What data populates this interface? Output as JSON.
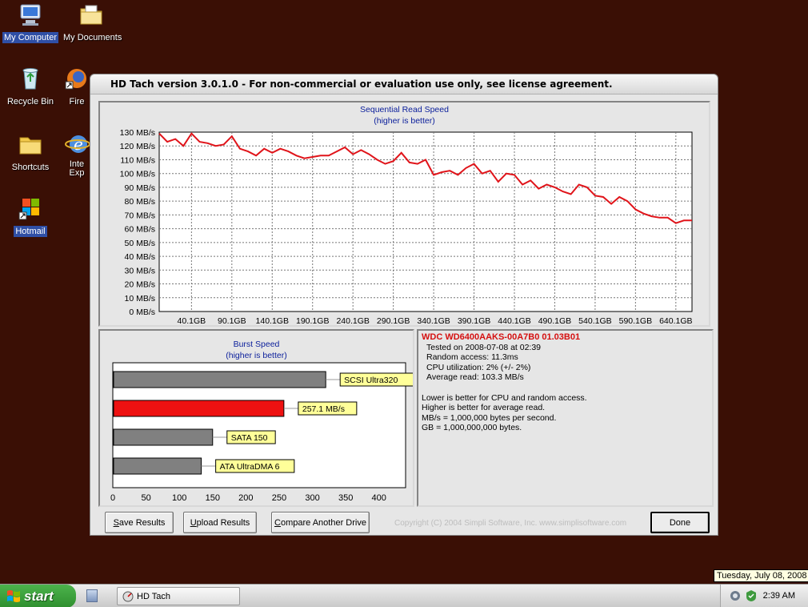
{
  "desktop": {
    "icons": [
      {
        "label": "My Computer"
      },
      {
        "label": "My Documents"
      },
      {
        "label": "Recycle Bin"
      },
      {
        "label": "Fire"
      },
      {
        "label": "Shortcuts"
      },
      {
        "label": "Inte Exp"
      },
      {
        "label": "Hotmail"
      }
    ]
  },
  "window": {
    "title": "HD Tach version 3.0.1.0  - For non-commercial or evaluation use only, see license agreement."
  },
  "seq_chart": {
    "title": "Sequential Read Speed",
    "subtitle": "(higher is better)",
    "y_ticks": [
      "130 MB/s",
      "120 MB/s",
      "110 MB/s",
      "100 MB/s",
      "90 MB/s",
      "80 MB/s",
      "70 MB/s",
      "60 MB/s",
      "50 MB/s",
      "40 MB/s",
      "30 MB/s",
      "20 MB/s",
      "10 MB/s",
      "0 MB/s"
    ],
    "x_ticks": [
      "40.1GB",
      "90.1GB",
      "140.1GB",
      "190.1GB",
      "240.1GB",
      "290.1GB",
      "340.1GB",
      "390.1GB",
      "440.1GB",
      "490.1GB",
      "540.1GB",
      "590.1GB",
      "640.1GB"
    ],
    "line_color": "#e0141a"
  },
  "chart_data": [
    {
      "type": "line",
      "title": "Sequential Read Speed",
      "subtitle": "(higher is better)",
      "xlabel": "",
      "ylabel": "",
      "xlim": [
        0,
        660
      ],
      "ylim": [
        0,
        130
      ],
      "grid": true,
      "x": [
        0,
        10,
        20,
        30,
        40,
        50,
        60,
        70,
        80,
        90,
        100,
        110,
        120,
        130,
        140,
        150,
        160,
        170,
        180,
        190,
        200,
        210,
        220,
        230,
        240,
        250,
        260,
        270,
        280,
        290,
        300,
        310,
        320,
        330,
        340,
        350,
        360,
        370,
        380,
        390,
        400,
        410,
        420,
        430,
        440,
        450,
        460,
        470,
        480,
        490,
        500,
        510,
        520,
        530,
        540,
        550,
        560,
        570,
        580,
        590,
        600,
        610,
        620,
        630,
        640,
        650,
        660
      ],
      "values": [
        129,
        123,
        125,
        120,
        129,
        123,
        122,
        120,
        121,
        127,
        118,
        116,
        113,
        118,
        115,
        118,
        116,
        113,
        111,
        112,
        113,
        113,
        116,
        119,
        114,
        117,
        114,
        110,
        107,
        109,
        115,
        108,
        107,
        110,
        99,
        101,
        102,
        99,
        104,
        107,
        100,
        102,
        94,
        100,
        99,
        92,
        95,
        89,
        92,
        90,
        87,
        85,
        92,
        90,
        84,
        83,
        78,
        83,
        80,
        74,
        71,
        69,
        68,
        68,
        64,
        66,
        66
      ],
      "series": [
        {
          "name": "WDC WD6400AAKS-00A7B0 01.03B01",
          "color": "#e0141a"
        }
      ]
    },
    {
      "type": "bar",
      "title": "Burst Speed",
      "subtitle": "(higher is better)",
      "orientation": "horizontal",
      "xlim": [
        0,
        440
      ],
      "x_ticks": [
        "0",
        "50",
        "100",
        "150",
        "200",
        "250",
        "300",
        "350",
        "400"
      ],
      "categories": [
        "SCSI Ultra320",
        "257.1 MB/s",
        "SATA 150",
        "ATA UltraDMA 6"
      ],
      "values": [
        320,
        257.1,
        150,
        133
      ],
      "colors": [
        "#808080",
        "#ee1111",
        "#808080",
        "#808080"
      ]
    }
  ],
  "drive_info": {
    "name": "WDC WD6400AAKS-00A7B0 01.03B01",
    "tested_on": "Tested on 2008-07-08 at 02:39",
    "random_access": "Random access: 11.3ms",
    "cpu_util": "CPU utilization: 2% (+/- 2%)",
    "avg_read": "Average read: 103.3 MB/s",
    "note1": "Lower is better for CPU and random access.",
    "note2": "Higher is better for average read.",
    "note3": "MB/s = 1,000,000 bytes per second.",
    "note4": "GB = 1,000,000,000 bytes."
  },
  "buttons": {
    "save_first": "S",
    "save_rest": "ave Results",
    "upload_first": "U",
    "upload_rest": "pload Results",
    "compare_first": "C",
    "compare_rest": "ompare Another Drive",
    "done": "Done"
  },
  "copyright": "Copyright (C) 2004 Simpli Software, Inc. www.simplisoftware.com",
  "taskbar": {
    "start": "start",
    "task": "HD Tach",
    "clock": "2:39 AM",
    "date_tooltip": "Tuesday, July 08, 2008"
  }
}
